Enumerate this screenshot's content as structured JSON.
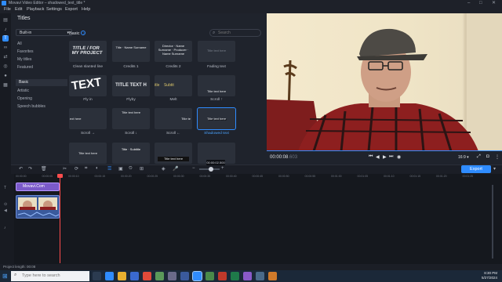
{
  "window": {
    "title": "Movavi Video Editor – shadowed_text_title *"
  },
  "menu": [
    "File",
    "Edit",
    "Playback",
    "Settings",
    "Export",
    "Help"
  ],
  "panel": {
    "title": "Titles",
    "category_select": "Built-in",
    "categories": [
      "All",
      "Favorites",
      "My titles",
      "Featured"
    ],
    "subcategories": [
      "Basic",
      "Artistic",
      "Opening",
      "Speech bubbles"
    ],
    "section_heading": "Basic",
    "search_placeholder": "Search",
    "tiles": [
      {
        "label": "Clean slanted line",
        "preview": "TITLE / FOR MY PROJECT"
      },
      {
        "label": "Credits 1",
        "preview": "Title · Name Surname"
      },
      {
        "label": "Credits 2",
        "preview": "Director · Name Surname · Producer · Name Surname"
      },
      {
        "label": "Fading text",
        "preview": "Title text here"
      },
      {
        "label": "Fly in",
        "preview": "TEXT"
      },
      {
        "label": "Flyby",
        "preview": "TITLE TEXT H"
      },
      {
        "label": "Melt",
        "preview": "itle    Subtit"
      },
      {
        "label": "Scroll ↑",
        "preview": "Title text here"
      },
      {
        "label": "Scroll →",
        "preview": "ext here"
      },
      {
        "label": "Scroll ↓",
        "preview": "Title text here"
      },
      {
        "label": "Scroll ←",
        "preview": "Title te"
      },
      {
        "label": "Shadowed text",
        "preview": "Title text here"
      },
      {
        "label": "",
        "preview": "Title text here"
      },
      {
        "label": "",
        "preview": "Title · Subtitle"
      },
      {
        "label": "",
        "preview": "Title text here"
      },
      {
        "label": "",
        "preview": ""
      }
    ]
  },
  "player": {
    "timecode": "00:00:08",
    "timecode_frac": ".603",
    "aspect": "16:9 ▾"
  },
  "timeline": {
    "export_label": "Export",
    "zoom_tooltip": "00:00:02.500",
    "title_clip": "Movavi.Com",
    "ruler": [
      "00:00:00",
      "00:00:05",
      "00:00:10",
      "00:00:15",
      "00:00:20",
      "00:00:25",
      "00:00:30",
      "00:00:35",
      "00:00:40",
      "00:00:45",
      "00:00:50",
      "00:00:55",
      "00:01:00",
      "00:01:05",
      "00:01:10",
      "00:01:15",
      "00:01:20",
      "00:01:25"
    ]
  },
  "status": {
    "text": "Project length: 00:08"
  },
  "taskbar": {
    "search_placeholder": "Type here to search",
    "time": "8:30 PM",
    "date": "5/27/2024"
  },
  "colors": {
    "accent": "#2f8cff",
    "title_clip": "#7b5ac9",
    "playhead": "#ff4d4d"
  }
}
